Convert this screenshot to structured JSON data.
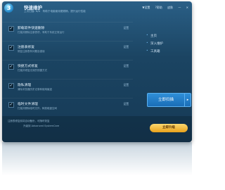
{
  "app": {
    "logo_text": "3",
    "title": "快速维护",
    "subtitle": "上次扫描: N/A　有助于电脑使用更顺畅，提升运行性能"
  },
  "titlebar": {
    "buttons": [
      "▼设置",
      "?帮助",
      "皮肤",
      "—",
      "✕"
    ]
  },
  "items": [
    {
      "title": "卸载软件快速删除",
      "desc": "扫描并删除注册表项，有助于系统正常运行",
      "setting": "设置",
      "checked": true
    },
    {
      "title": "注册表修复",
      "desc": "修复注册表有问题及错误",
      "setting": "设置",
      "checked": true
    },
    {
      "title": "快捷方式修复",
      "desc": "扫描并修复无效的快捷方式",
      "setting": "设置",
      "checked": true
    },
    {
      "title": "隐私清理",
      "desc": "清除浏览器历史记录和使用痕迹",
      "setting": "设置",
      "checked": true
    },
    {
      "title": "临时文件清理",
      "desc": "扫描并删除临时文件，释放磁盘空间",
      "setting": "设置",
      "checked": true
    }
  ],
  "side_nav": [
    "主页",
    "深入维护",
    "工具箱"
  ],
  "scan_button": "立即扫描",
  "scan_arrow": "▸",
  "footer": {
    "line1": "注册表修复前将自动备份，可随时恢复",
    "line2": "升级到 Advanced SystemCare",
    "upgrade_button": "立即升级"
  },
  "colors": {
    "window_bg": "#1b4462",
    "accent": "#2f8fd8",
    "upgrade": "#e8a21c"
  }
}
